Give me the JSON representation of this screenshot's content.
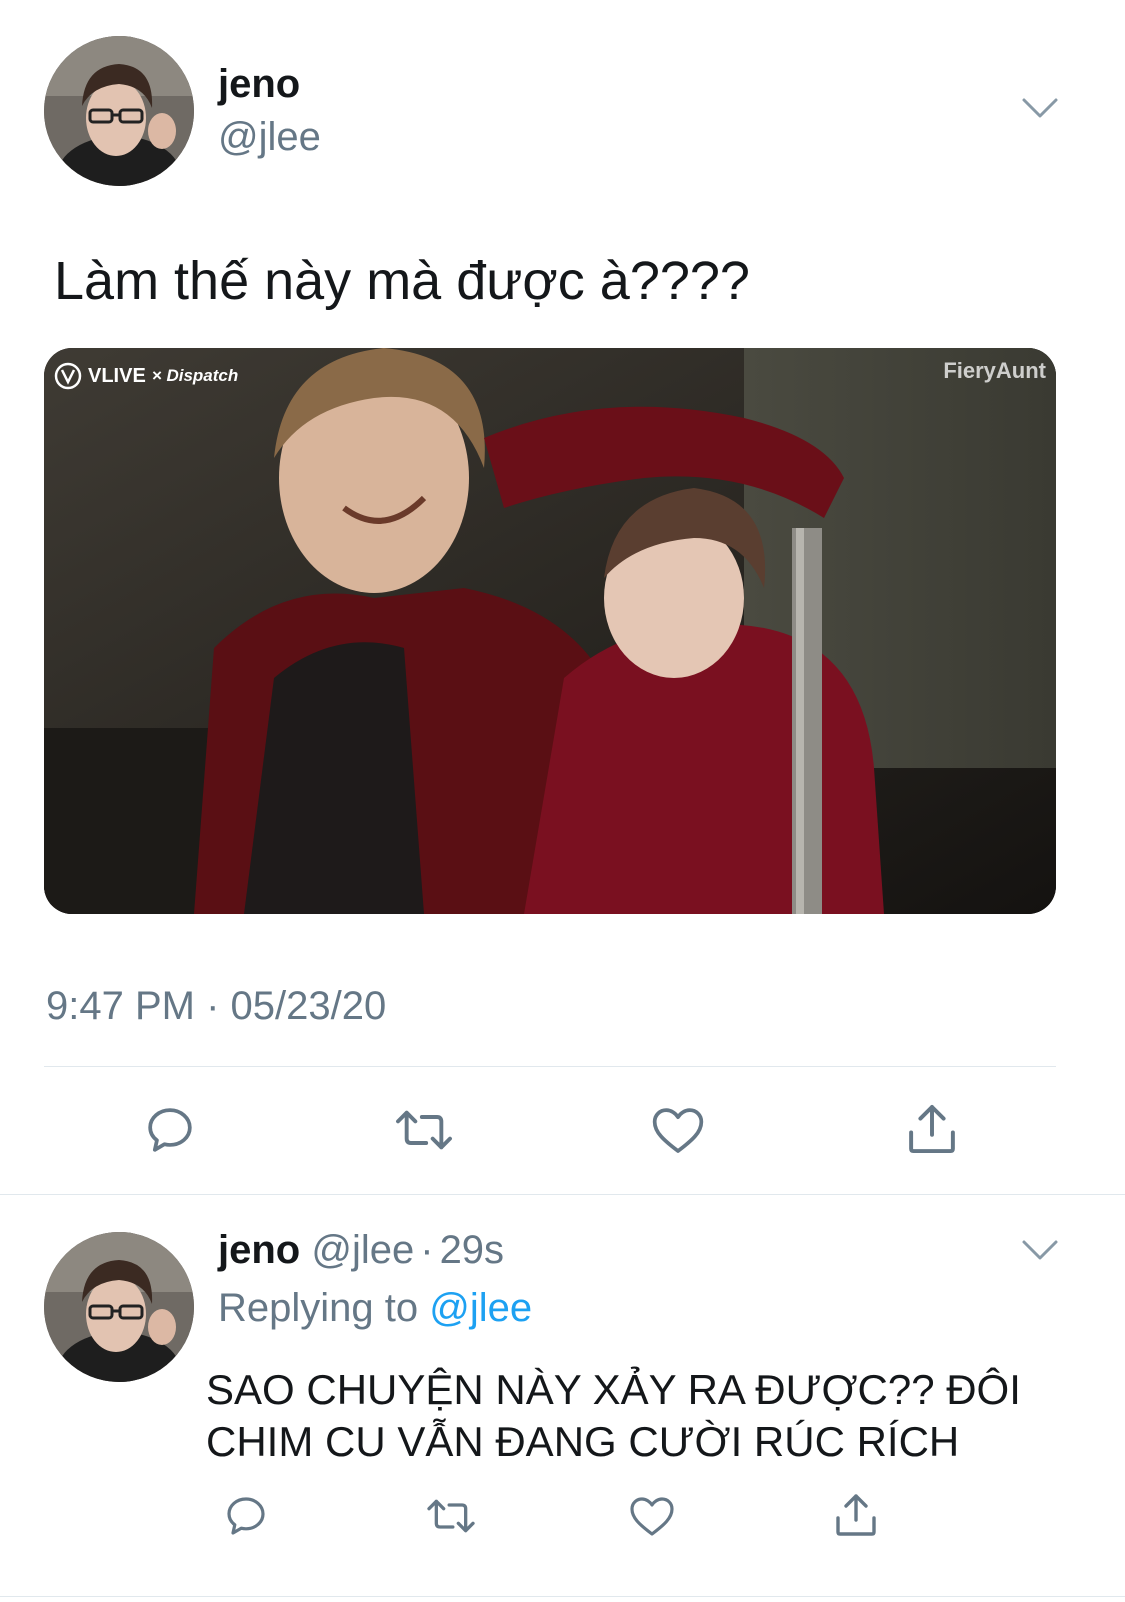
{
  "main_tweet": {
    "display_name": "jeno",
    "handle": "@jlee",
    "text": "Làm thế này mà được à????",
    "media": {
      "watermark_left": "VLIVE",
      "watermark_left_sub": "× Dispatch",
      "watermark_right": "FieryAunt"
    },
    "timestamp": "9:47 PM · 05/23/20"
  },
  "reply_tweet": {
    "display_name": "jeno",
    "handle": "@jlee",
    "separator": "·",
    "time_ago": "29s",
    "replying_prefix": "Replying to",
    "replying_handle": "@jlee",
    "text_line1": "SAO CHUYỆN NÀY XẢY RA ĐƯỢC?? ĐÔI",
    "text_line2": "CHIM CU VẪN ĐANG CƯỜI RÚC RÍCH"
  },
  "icons": {
    "reply": "reply-icon",
    "retweet": "retweet-icon",
    "like": "heart-icon",
    "share": "share-icon",
    "menu": "chevron-down-icon"
  },
  "colors": {
    "text": "#14171a",
    "muted": "#657786",
    "link": "#1da1f2",
    "divider": "#e1e8ed"
  }
}
